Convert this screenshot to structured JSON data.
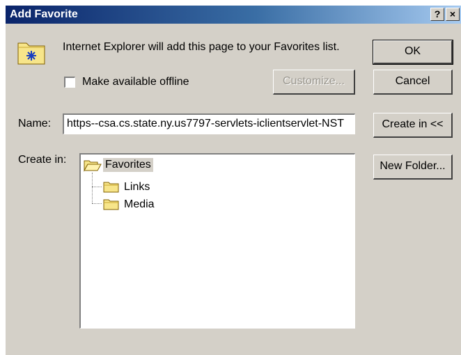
{
  "window": {
    "title": "Add Favorite",
    "help_label": "?",
    "close_label": "×"
  },
  "message": "Internet Explorer will add this page to your Favorites list.",
  "offline": {
    "label": "Make available offline",
    "checked": false
  },
  "buttons": {
    "ok": "OK",
    "cancel": "Cancel",
    "customize": "Customize...",
    "create_in": "Create in <<",
    "new_folder": "New Folder..."
  },
  "name_field": {
    "label": "Name:",
    "value": "https--csa.cs.state.ny.us7797-servlets-iclientservlet-NST"
  },
  "create_in_label": "Create in:",
  "tree": {
    "root": "Favorites",
    "children": [
      "Links",
      "Media"
    ]
  },
  "colors": {
    "dialog_bg": "#d4d0c8",
    "title_gradient_start": "#0a246a",
    "title_gradient_end": "#a6caf0",
    "folder": "#f7e58a"
  },
  "icons": {
    "favorites_icon": "favorites-folder-star-icon",
    "folder_icon": "folder-icon",
    "open_folder_icon": "open-folder-icon"
  }
}
